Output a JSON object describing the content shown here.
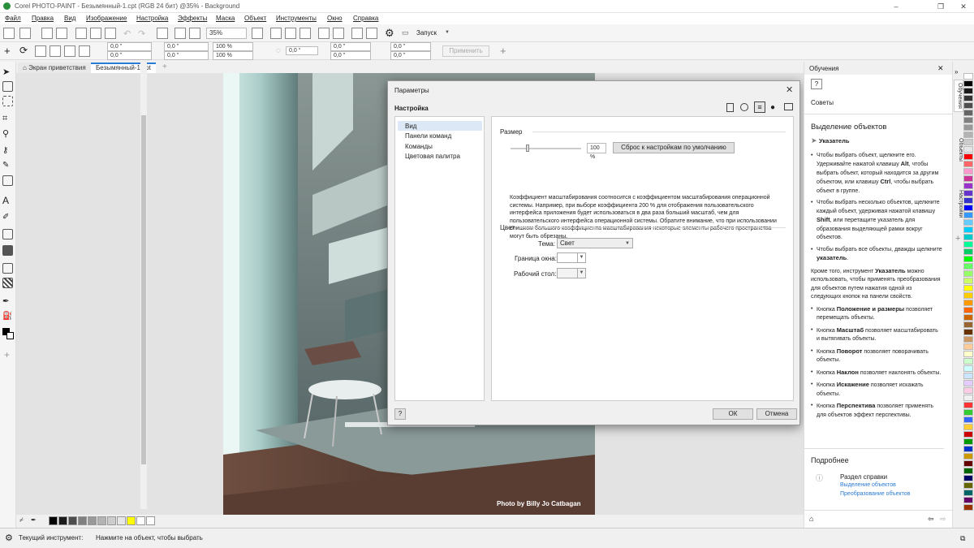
{
  "window": {
    "title": "Corel PHOTO-PAINT - Безымянный-1.cpt (RGB 24 бит) @35% - Background",
    "controls": [
      "–",
      "❐",
      "✕"
    ]
  },
  "menu": [
    "Файл",
    "Правка",
    "Вид",
    "Изображение",
    "Настройка",
    "Эффекты",
    "Маска",
    "Объект",
    "Инструменты",
    "Окно",
    "Справка"
  ],
  "toolbar": {
    "zoom": "35%",
    "launch": "Запуск"
  },
  "propbar": {
    "x1": "0,0 \"",
    "y1": "0,0 \"",
    "w1": "0,0 \"",
    "h1": "0,0 \"",
    "sx": "100 %",
    "sy": "100 %",
    "rot": "0,0 °",
    "x2": "0,0 \"",
    "y2": "0,0 \"",
    "x3": "0,0 \"",
    "y3": "0,0 \"",
    "apply": "Применить"
  },
  "tabs": [
    "Экран приветствия",
    "Безымянный-1.cpt"
  ],
  "photo_credit": "Photo by Billy Jo Catbagan",
  "dialog": {
    "title": "Параметры",
    "heading": "Настройка",
    "nav": [
      "Вид",
      "Панели команд",
      "Команды",
      "Цветовая палитра"
    ],
    "size_label": "Размер",
    "scale_value": "100 %",
    "reset_button": "Сброс к настройкам по умолчанию",
    "description": "Коэффициент масштабирования соотносится с коэффициентом масштабирования операционной системы. Например, при выборе коэффициента 200 % для отображения пользовательского интерфейса приложения будет использоваться в два раза больший масштаб, чем для пользовательского интерфейса операционной системы. Обратите внимание, что при использовании слишком большого коэффициента масштабирования некоторые элементы рабочего пространства могут быть обрезаны.",
    "color_label": "Цвет",
    "theme_label": "Тема:",
    "theme_value": "Свет",
    "border_label": "Граница окна:",
    "desktop_label": "Рабочий стол:",
    "help": "?",
    "ok": "ОК",
    "cancel": "Отмена"
  },
  "learning": {
    "panel_title": "Обучения",
    "tips_label": "Советы",
    "section_title": "Выделение объектов",
    "tool_name": "Указатель",
    "bullets1": [
      [
        "Чтобы выбрать объект, щелкните его. Удерживайте нажатой клавишу ",
        "Alt",
        ", чтобы выбрать объект, который находится за другим объектом, или клавишу ",
        "Ctrl",
        ", чтобы выбрать объект в группе."
      ],
      [
        "Чтобы выбрать несколько объектов, щелкните каждый объект, удерживая нажатой клавишу ",
        "Shift",
        ", или перетащите указатель для образования выделяющей рамки вокруг объектов."
      ],
      [
        "Чтобы выбрать все объекты, дважды щелкните ",
        "указатель",
        "."
      ]
    ],
    "para_pre": "Кроме того, инструмент ",
    "para_bold": "Указатель",
    "para_post": " можно использовать, чтобы применять преобразования для объектов путем нажатия одной из следующих кнопок на панели свойств.",
    "bullets2": [
      [
        "Кнопка ",
        "Положение и размеры",
        " позволяет перемещать объекты."
      ],
      [
        "Кнопка ",
        "Масштаб",
        " позволяет масштабировать и вытягивать объекты."
      ],
      [
        "Кнопка ",
        "Поворот",
        " позволяет поворачивать объекты."
      ],
      [
        "Кнопка ",
        "Наклон",
        " позволяет наклонять объекты."
      ],
      [
        "Кнопка ",
        "Искажение",
        " позволяет искажать объекты."
      ],
      [
        "Кнопка ",
        "Перспектива",
        " позволяет применять для объектов эффект перспективы."
      ]
    ],
    "more_title": "Подробнее",
    "help_section": "Раздел справки",
    "links": [
      "Выделение объектов",
      "Преобразование объектов"
    ]
  },
  "docker_tabs": [
    "Обучения",
    "Объекты",
    "Настройки"
  ],
  "status": {
    "label": "Текущий инструмент:",
    "hint": "Нажмите на объект, чтобы выбрать"
  },
  "colors": {
    "accent": "#2b7bd6",
    "palette": [
      "#ffffff",
      "#000000",
      "#1a1a1a",
      "#333333",
      "#4d4d4d",
      "#666666",
      "#808080",
      "#999999",
      "#b3b3b3",
      "#cccccc",
      "#e6e6e6",
      "#ff0000",
      "#ff6666",
      "#ff99cc",
      "#cc3399",
      "#9933cc",
      "#6633cc",
      "#3333cc",
      "#0000ff",
      "#3399ff",
      "#66ccff",
      "#00ccff",
      "#00cccc",
      "#00ff99",
      "#00cc66",
      "#00ff00",
      "#66ff66",
      "#99ff66",
      "#ccff66",
      "#ffff00",
      "#ffcc00",
      "#ff9900",
      "#ff6600",
      "#cc6600",
      "#996633",
      "#663300",
      "#cc9966",
      "#ffcc99",
      "#ffffcc",
      "#ccffcc",
      "#ccffff",
      "#cce5ff",
      "#e5ccff",
      "#ffcce5",
      "#f0f0f0",
      "#ff3333",
      "#33cc33",
      "#3366ff",
      "#ffcc33",
      "#cc0000",
      "#009900",
      "#0033cc",
      "#cc9900",
      "#660000",
      "#006600",
      "#000066",
      "#666600",
      "#006666",
      "#660066",
      "#993300"
    ],
    "bottom_palette": [
      "#000000",
      "#1a1a1a",
      "#4d4d4d",
      "#808080",
      "#999999",
      "#b3b3b3",
      "#cccccc",
      "#e6e6e6",
      "#ffff00",
      "#ffffff",
      "#ffffff"
    ]
  }
}
